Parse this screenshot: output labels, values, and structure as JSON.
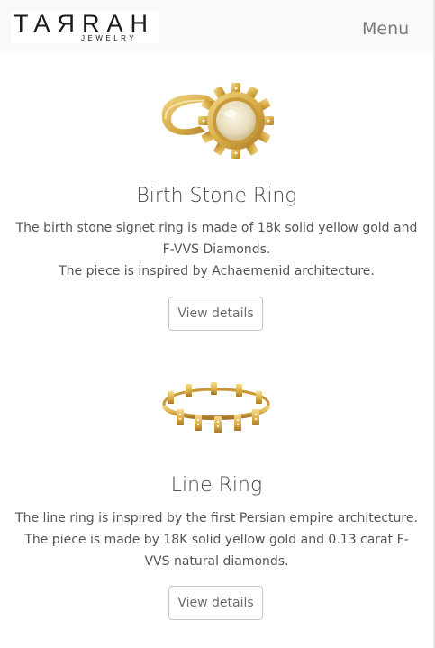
{
  "header": {
    "brand_main": "TAЯRAH",
    "brand_sub": "JEWELRY",
    "menu_label": "Menu"
  },
  "products": [
    {
      "title": "Birth Stone Ring",
      "description_lines": [
        "The birth stone signet ring is made of 18k solid yellow gold and",
        "F-VVS Diamonds.",
        "The piece is inspired by Achaemenid architecture."
      ],
      "button_label": "View details"
    },
    {
      "title": "Line Ring",
      "description_lines": [
        "The line ring is inspired by the first Persian empire architecture.",
        "The piece is made by 18K solid yellow gold and 0.13 carat F-",
        "VVS natural diamonds."
      ],
      "button_label": "View details"
    }
  ],
  "colors": {
    "navbar_bg": "#f8f9fa",
    "gold": "#d9b45a",
    "text": "#555555"
  }
}
